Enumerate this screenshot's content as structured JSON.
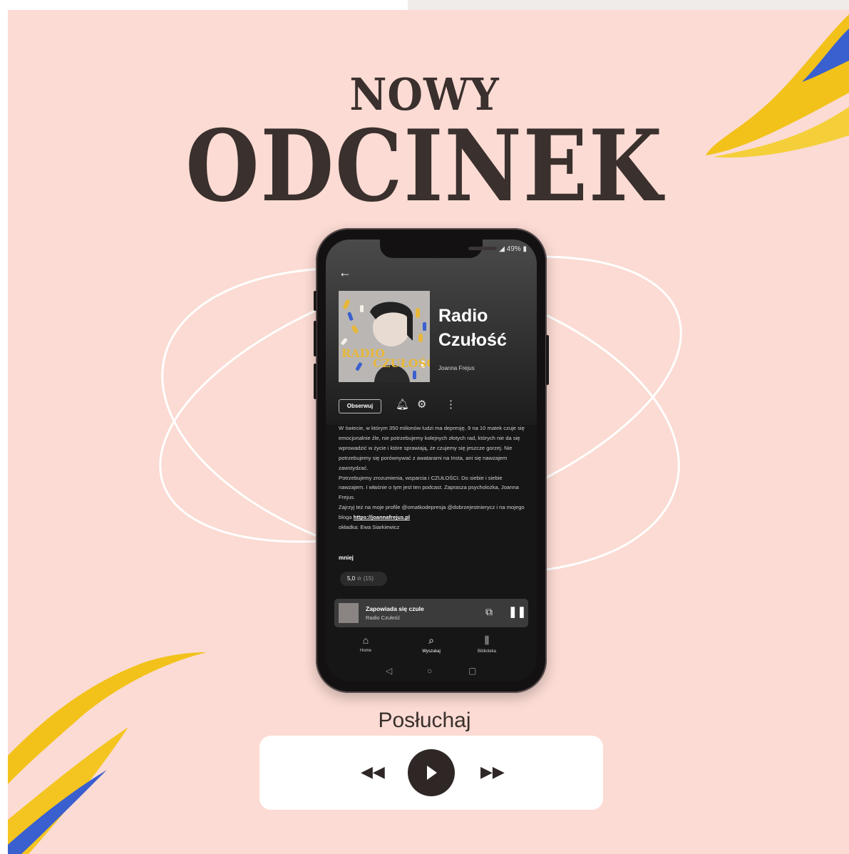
{
  "heading": {
    "line1": "NOWY",
    "line2": "ODCINEK"
  },
  "phone": {
    "status_battery": "49%",
    "back_icon": "arrow-left-icon",
    "cover": {
      "text_line1": "RADIO",
      "text_line2": "CZUŁOŚĆ"
    },
    "podcast_title": "Radio Czułość",
    "author": "Joanna Frejus",
    "follow_label": "Obserwuj",
    "description": [
      "W świecie, w którym 350 milionów ludzi ma depresję, 9 na 10 matek czuje się emocjonalnie źle, nie potrzebujemy kolejnych złotych rad, których nie da się wprowadzić w życie i które sprawiają, że czujemy się jeszcze gorzej. Nie potrzebujemy się porównywać z awatarami na Insta, ani się nawzajem zawstydzać.",
      "Potrzebujemy zrozumienia, wsparcia i CZUŁOŚCI. Do siebie i siebie nawzajem. I właśnie o tym jest ten podcast. Zaprasza psycholożka, Joanna Frejus.",
      "Zajrzyj też na moje profile @omatkodepresja @dobrzejestnierycz i na mojego bloga",
      "okładka: Ewa Siarkiewicz"
    ],
    "blog_link": "https://joannafrejus.pl",
    "less_label": "mniej",
    "rating": {
      "score": "5,0",
      "count": "(15)"
    },
    "now_playing": {
      "title": "Zapowiada się czule",
      "subtitle": "Radio Czułość"
    },
    "nav": [
      {
        "label": "Home",
        "icon": "home-icon"
      },
      {
        "label": "Wyszukaj",
        "icon": "search-icon"
      },
      {
        "label": "Biblioteka",
        "icon": "library-icon"
      }
    ]
  },
  "listen_label": "Posłuchaj",
  "colors": {
    "background": "#fbdbd3",
    "text_dark": "#3a302d",
    "accent_yellow": "#f2c21a",
    "accent_blue": "#3a5fcf"
  }
}
